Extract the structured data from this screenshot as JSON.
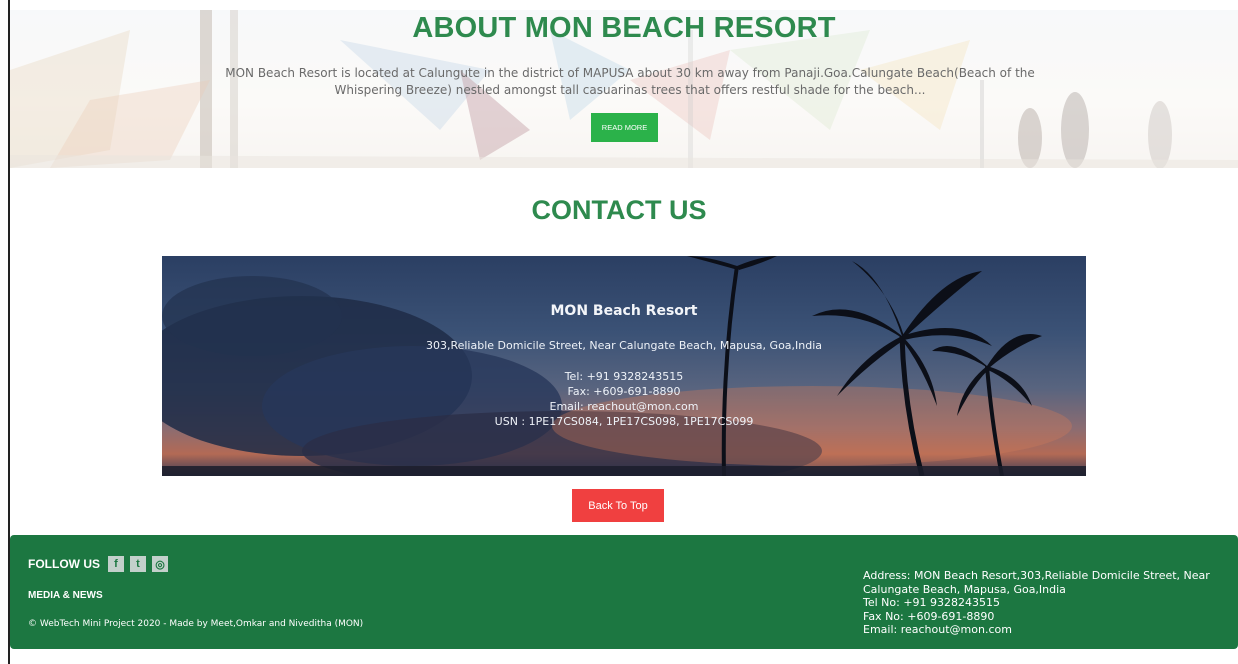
{
  "about": {
    "title": "ABOUT MON BEACH RESORT",
    "text": "MON Beach Resort is located at Calungute in the district of MAPUSA about 30 km away from Panaji.Goa.Calungate Beach(Beach of the Whispering Breeze) nestled amongst tall casuarinas trees that offers restful shade for the beach...",
    "read_more": "READ MORE"
  },
  "contact": {
    "title": "CONTACT US",
    "name": "MON Beach Resort",
    "address": "303,Reliable Domicile Street, Near Calungate Beach, Mapusa, Goa,India",
    "tel": "Tel: +91 9328243515",
    "fax": "Fax: +609-691-8890",
    "email": "Email: reachout@mon.com",
    "usn": "USN : 1PE17CS084, 1PE17CS098, 1PE17CS099"
  },
  "back_to_top": "Back To Top",
  "footer": {
    "follow_label": "FOLLOW US",
    "social": [
      {
        "icon": "facebook-icon",
        "glyph": "f"
      },
      {
        "icon": "twitter-icon",
        "glyph": "t"
      },
      {
        "icon": "instagram-icon",
        "glyph": "◎"
      }
    ],
    "media_news": "MEDIA & NEWS",
    "copyright": "© WebTech Mini Project 2020 - Made by Meet,Omkar and Niveditha (MON)",
    "address_lines": [
      "Address: MON Beach Resort,303,Reliable Domicile Street, Near",
      "Calungate Beach, Mapusa, Goa,India",
      "Tel No: +91 9328243515",
      "Fax No: +609-691-8890",
      "Email: reachout@mon.com"
    ]
  },
  "colors": {
    "accent_green": "#2e8a4e",
    "footer_green": "#1c7741",
    "button_green": "#2bb24a",
    "button_red": "#f04040"
  }
}
